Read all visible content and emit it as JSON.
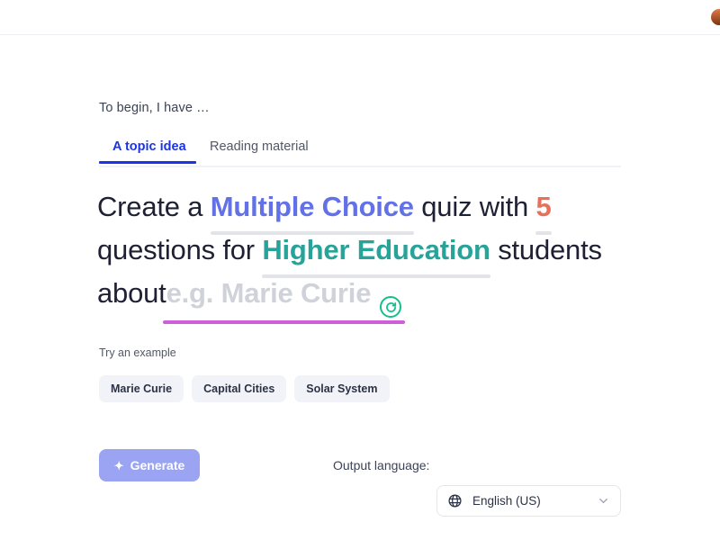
{
  "header": {
    "avatar_icon": "user-avatar-icon"
  },
  "main": {
    "lead_text": "To begin, I have …",
    "tabs": [
      {
        "label": "A topic idea",
        "active": true
      },
      {
        "label": "Reading material",
        "active": false
      }
    ],
    "prompt": {
      "part1": "Create a",
      "quiz_type": "Multiple Choice",
      "part2": "quiz with",
      "question_count": "5",
      "part3": "questions for",
      "audience": "Higher Education",
      "part4": "students about",
      "topic_placeholder": "e.g. Marie Curie",
      "refresh_icon": "refresh-icon"
    },
    "examples": {
      "label": "Try an example",
      "chips": [
        "Marie Curie",
        "Capital Cities",
        "Solar System"
      ]
    },
    "footer": {
      "generate_label": "Generate",
      "generate_icon": "sparkle-icon",
      "language_label": "Output language:",
      "language_value": "English (US)",
      "globe_icon": "globe-icon",
      "chevron_icon": "chevron-down-icon"
    }
  },
  "colors": {
    "quiz_type": "#6271e8",
    "question_count": "#e8705a",
    "audience": "#28a39a",
    "topic_underline": "#cf5fd8",
    "tab_active": "#1c34e8",
    "generate_button": "#9aa4f2",
    "refresh_accent": "#12c08a"
  }
}
